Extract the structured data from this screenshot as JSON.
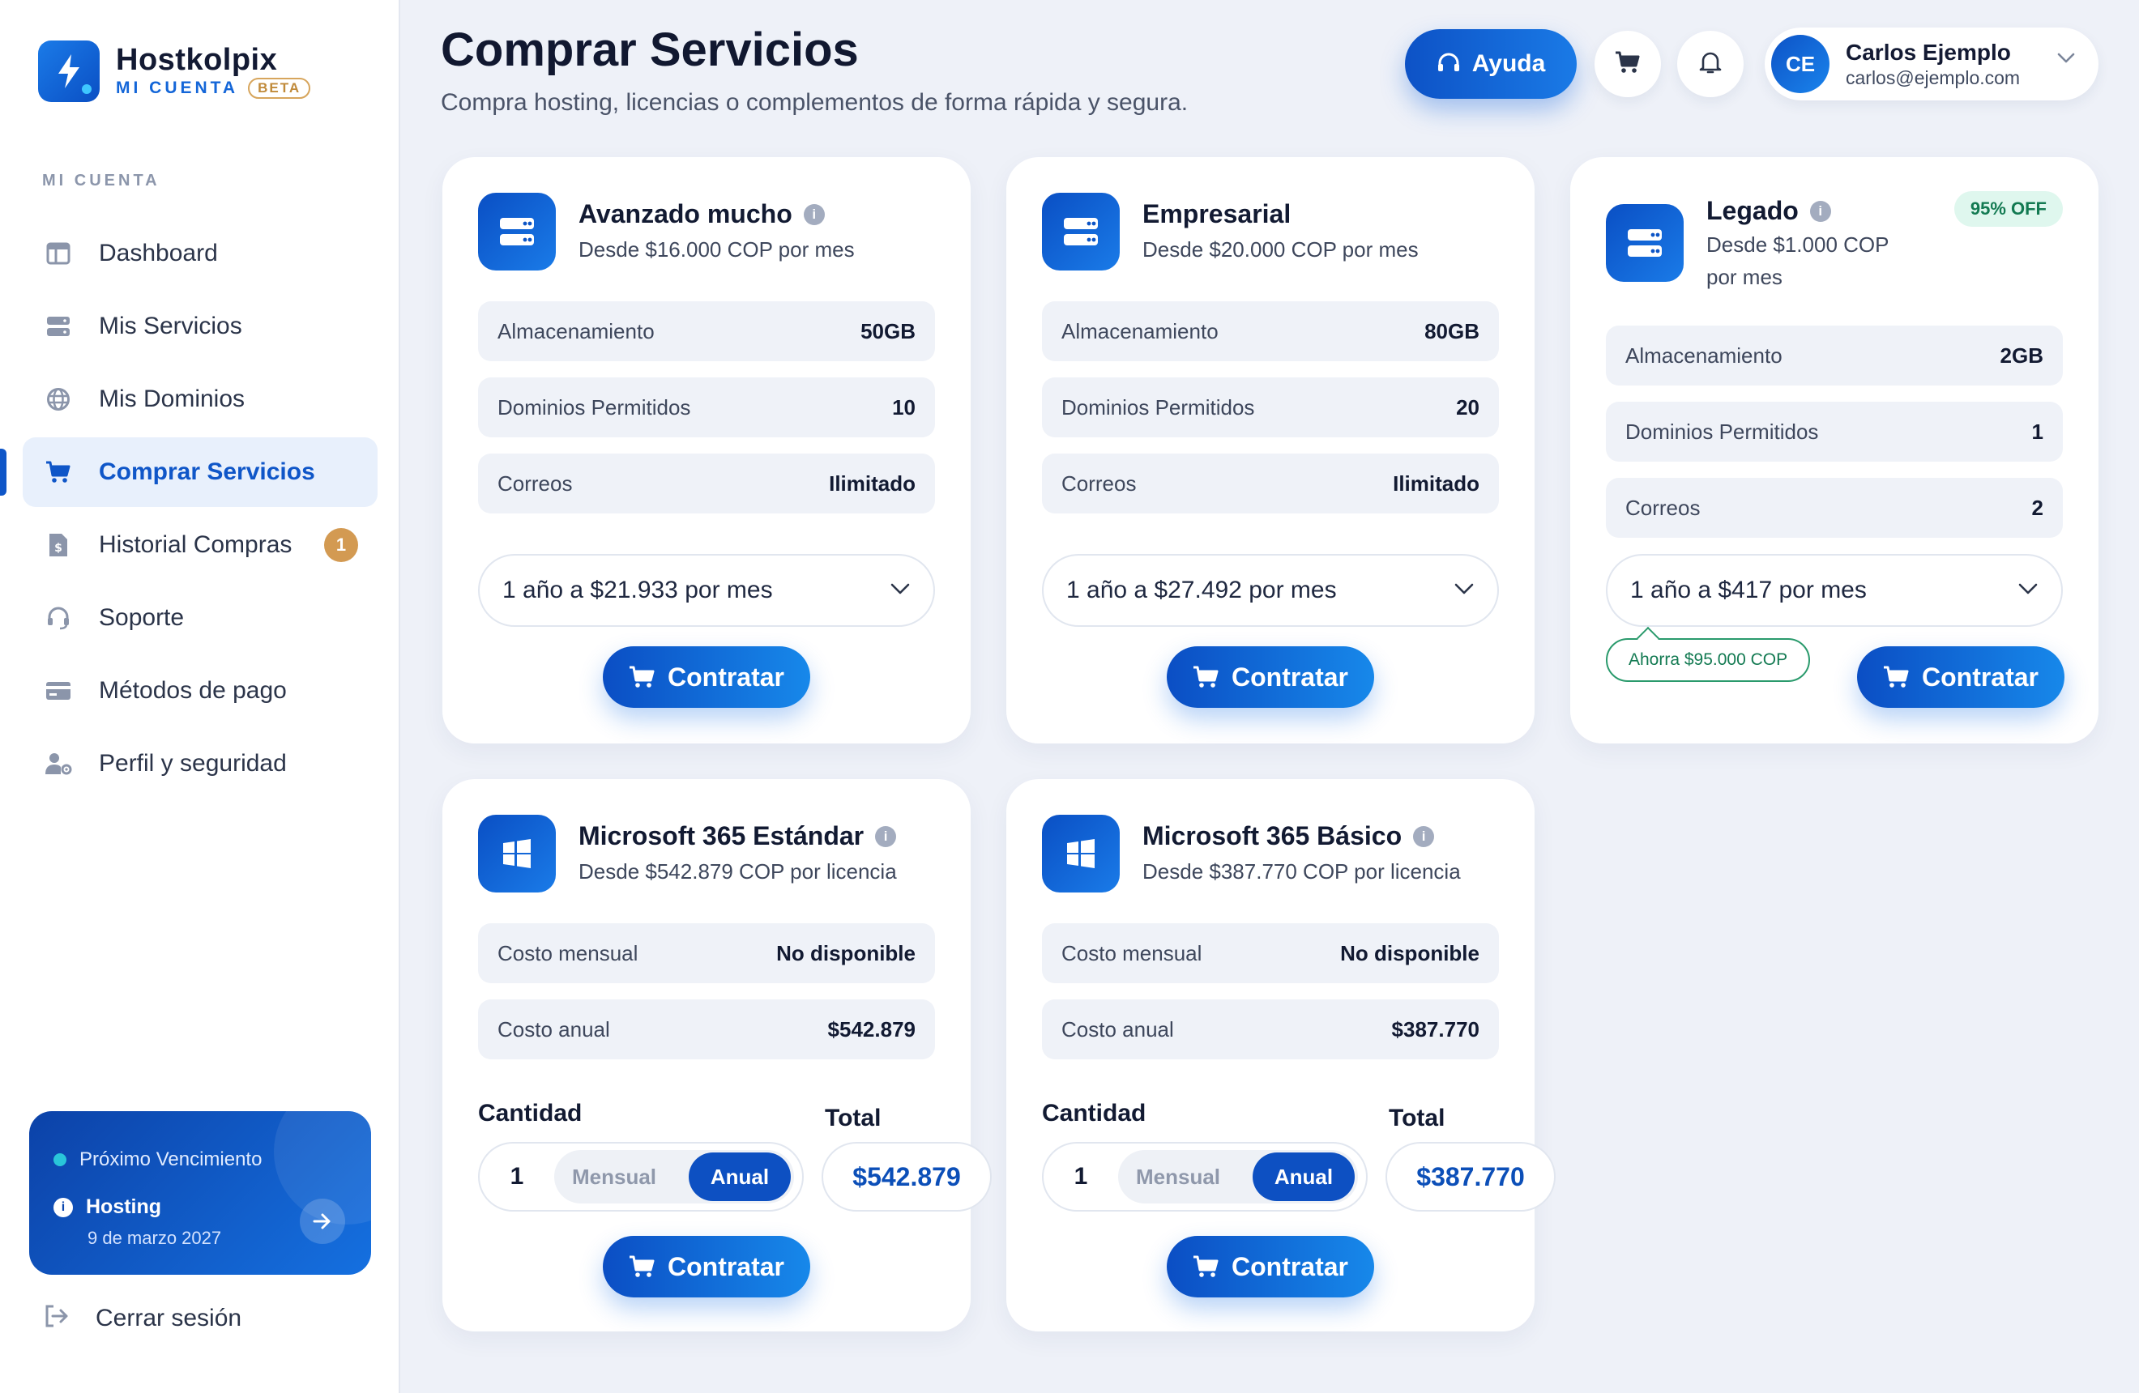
{
  "brand": {
    "name": "Hostkolpix",
    "subtitle": "MI CUENTA",
    "badge": "BETA"
  },
  "sidebar": {
    "section_label": "MI CUENTA",
    "items": [
      {
        "label": "Dashboard",
        "icon": "dashboard-icon"
      },
      {
        "label": "Mis Servicios",
        "icon": "server-icon"
      },
      {
        "label": "Mis Dominios",
        "icon": "globe-icon"
      },
      {
        "label": "Comprar Servicios",
        "icon": "cart-icon",
        "active": true
      },
      {
        "label": "Historial Compras",
        "icon": "invoice-icon",
        "badge": "1"
      },
      {
        "label": "Soporte",
        "icon": "headset-icon"
      },
      {
        "label": "Métodos de pago",
        "icon": "credit-card-icon"
      },
      {
        "label": "Perfil y seguridad",
        "icon": "user-gear-icon"
      }
    ],
    "expiry": {
      "title": "Próximo Vencimiento",
      "service": "Hosting",
      "date": "9 de marzo 2027"
    },
    "logout": "Cerrar sesión"
  },
  "header": {
    "title": "Comprar Servicios",
    "subtitle": "Compra hosting, licencias o complementos de forma rápida y segura.",
    "help_label": "Ayuda",
    "user": {
      "initials": "CE",
      "name": "Carlos Ejemplo",
      "email": "carlos@ejemplo.com"
    }
  },
  "plans": [
    {
      "name": "Avanzado mucho",
      "price": "Desde $16.000 COP por mes",
      "specs": [
        {
          "k": "Almacenamiento",
          "v": "50GB"
        },
        {
          "k": "Dominios Permitidos",
          "v": "10"
        },
        {
          "k": "Correos",
          "v": "Ilimitado"
        }
      ],
      "period": "1 año a $21.933 por mes",
      "cta": "Contratar"
    },
    {
      "name": "Empresarial",
      "price": "Desde $20.000 COP por mes",
      "specs": [
        {
          "k": "Almacenamiento",
          "v": "80GB"
        },
        {
          "k": "Dominios Permitidos",
          "v": "20"
        },
        {
          "k": "Correos",
          "v": "Ilimitado"
        }
      ],
      "period": "1 año a $27.492 por mes",
      "cta": "Contratar"
    },
    {
      "name": "Legado",
      "price_line1": "Desde $1.000 COP",
      "price_line2": "por mes",
      "discount": "95% OFF",
      "specs": [
        {
          "k": "Almacenamiento",
          "v": "2GB"
        },
        {
          "k": "Dominios Permitidos",
          "v": "1"
        },
        {
          "k": "Correos",
          "v": "2"
        }
      ],
      "period": "1 año a $417 por mes",
      "savings": "Ahorra $95.000 COP",
      "cta": "Contratar"
    }
  ],
  "licenses": [
    {
      "name": "Microsoft 365 Estándar",
      "price": "Desde $542.879 COP por licencia",
      "specs": [
        {
          "k": "Costo mensual",
          "v": "No disponible"
        },
        {
          "k": "Costo anual",
          "v": "$542.879"
        }
      ],
      "qty_label": "Cantidad",
      "total_label": "Total",
      "qty": "1",
      "opt_monthly": "Mensual",
      "opt_annual": "Anual",
      "total": "$542.879",
      "cta": "Contratar"
    },
    {
      "name": "Microsoft 365 Básico",
      "price": "Desde $387.770 COP por licencia",
      "specs": [
        {
          "k": "Costo mensual",
          "v": "No disponible"
        },
        {
          "k": "Costo anual",
          "v": "$387.770"
        }
      ],
      "qty_label": "Cantidad",
      "total_label": "Total",
      "qty": "1",
      "opt_monthly": "Mensual",
      "opt_annual": "Anual",
      "total": "$387.770",
      "cta": "Contratar"
    }
  ],
  "colors": {
    "primary": "#0f56c8",
    "accent": "#1a7be8",
    "success": "#137a52",
    "badge": "#d39a52"
  }
}
